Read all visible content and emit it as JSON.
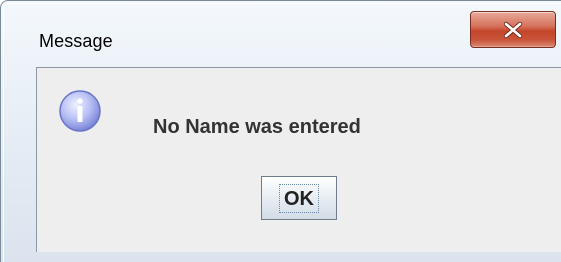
{
  "window": {
    "title": "Message"
  },
  "dialog": {
    "icon": "information-icon",
    "message": "No Name was entered",
    "ok_label": "OK"
  },
  "colors": {
    "close_button": "#c4452a",
    "client_background": "#eeeeee",
    "info_icon": "#7c86d9"
  }
}
